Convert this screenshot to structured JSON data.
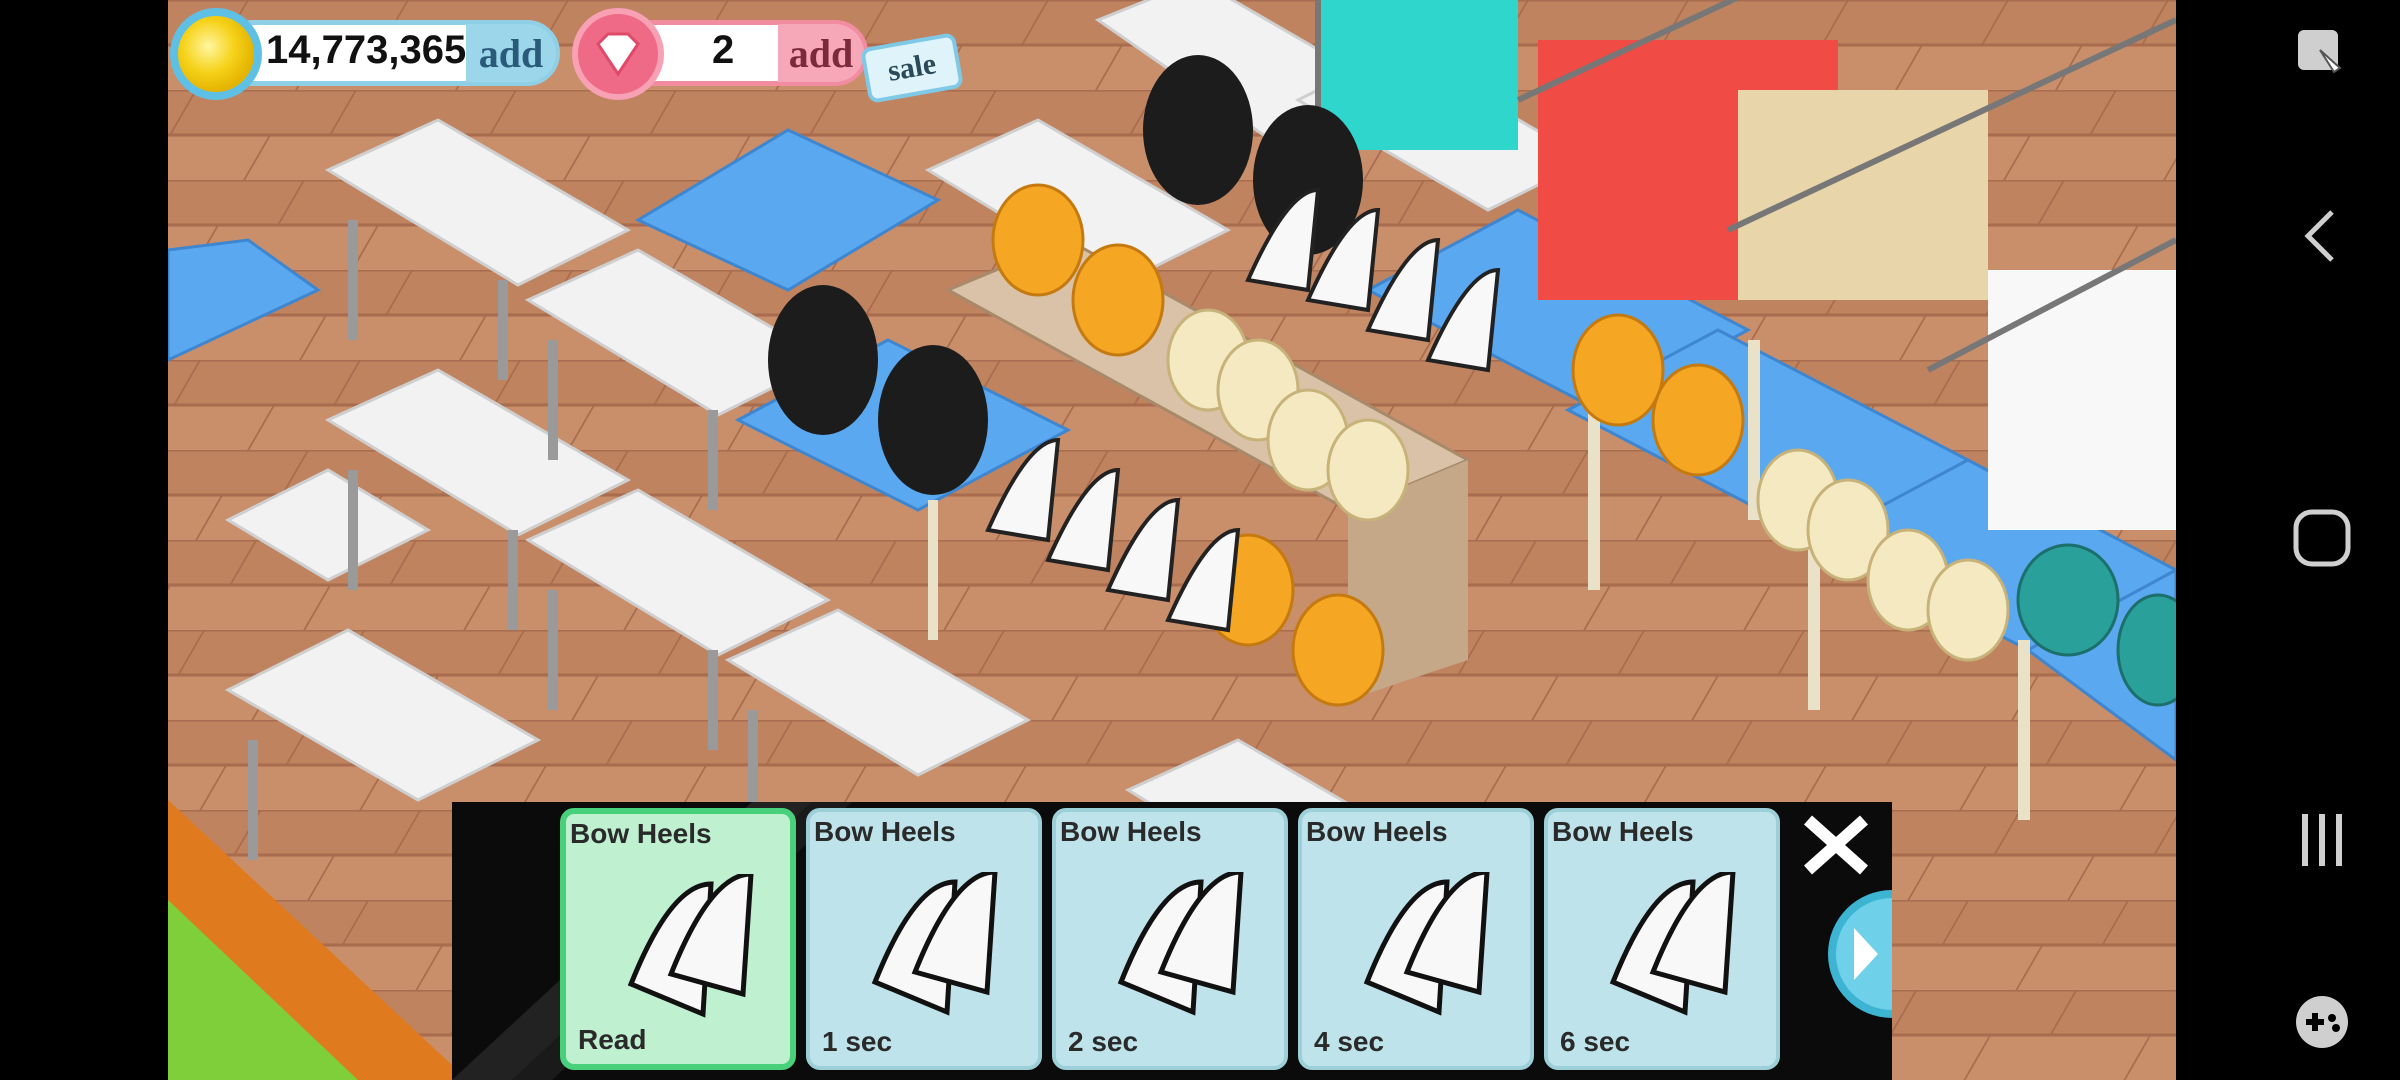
{
  "hud": {
    "coins": "14,773,365",
    "coin_add_label": "add",
    "gems": "2",
    "gem_add_label": "add",
    "sale_label": "sale"
  },
  "tray": {
    "items": [
      {
        "name": "Bow Heels",
        "status": "Read",
        "selected": true
      },
      {
        "name": "Bow Heels",
        "status": "1 sec",
        "selected": false
      },
      {
        "name": "Bow Heels",
        "status": "2 sec",
        "selected": false
      },
      {
        "name": "Bow Heels",
        "status": "4 sec",
        "selected": false
      },
      {
        "name": "Bow Heels",
        "status": "6 sec",
        "selected": false
      }
    ],
    "close_icon": "close-x-icon",
    "next_icon": "next-arrow-icon"
  },
  "system_nav": {
    "icons": [
      "screen-lock-icon",
      "back-icon",
      "home-icon",
      "recents-icon",
      "game-tools-icon"
    ]
  },
  "colors": {
    "floor": "#c98e6a",
    "table_white": "#f2f2f2",
    "table_blue": "#5aa8f0",
    "selected_card": "#bff0d0",
    "card": "#bfe3ea"
  }
}
